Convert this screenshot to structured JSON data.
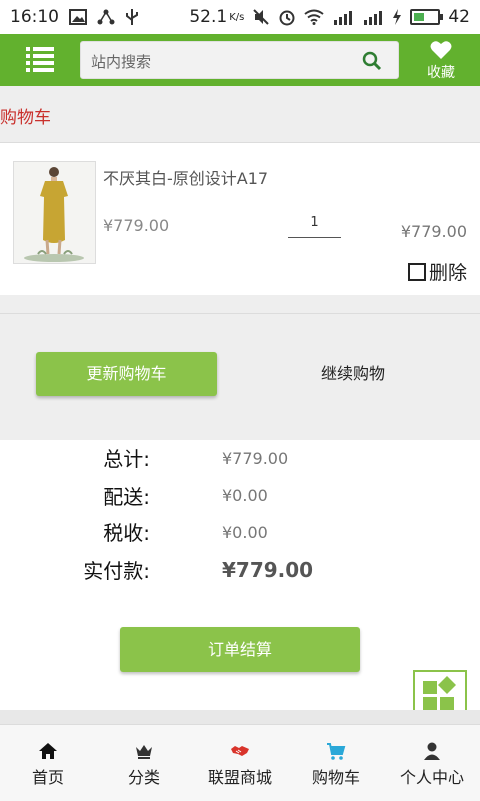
{
  "status_bar": {
    "time": "16:10",
    "speed": "52.1",
    "speed_unit": "K/s",
    "battery": "42"
  },
  "header": {
    "search_placeholder": "站内搜索",
    "favorites_label": "收藏"
  },
  "page_title": "购物车",
  "cart_item": {
    "name": "不厌其白-原创设计A17",
    "unit_price": "¥779.00",
    "quantity": "1",
    "line_total": "¥779.00",
    "delete_label": "删除"
  },
  "actions": {
    "update_cart": "更新购物车",
    "continue_shopping": "继续购物"
  },
  "totals": {
    "subtotal_label": "总计:",
    "subtotal_value": "¥779.00",
    "shipping_label": "配送:",
    "shipping_value": "¥0.00",
    "tax_label": "税收:",
    "tax_value": "¥0.00",
    "paid_label": "实付款:",
    "paid_value": "¥779.00"
  },
  "checkout_label": "订单结算",
  "bottom_nav": {
    "home": "首页",
    "category": "分类",
    "alliance_mall": "联盟商城",
    "cart": "购物车",
    "profile": "个人中心"
  },
  "colors": {
    "header_green": "#62b12e",
    "button_green": "#8bc34a",
    "title_red": "#c9302c",
    "cart_icon_blue": "#2aa8d8"
  }
}
